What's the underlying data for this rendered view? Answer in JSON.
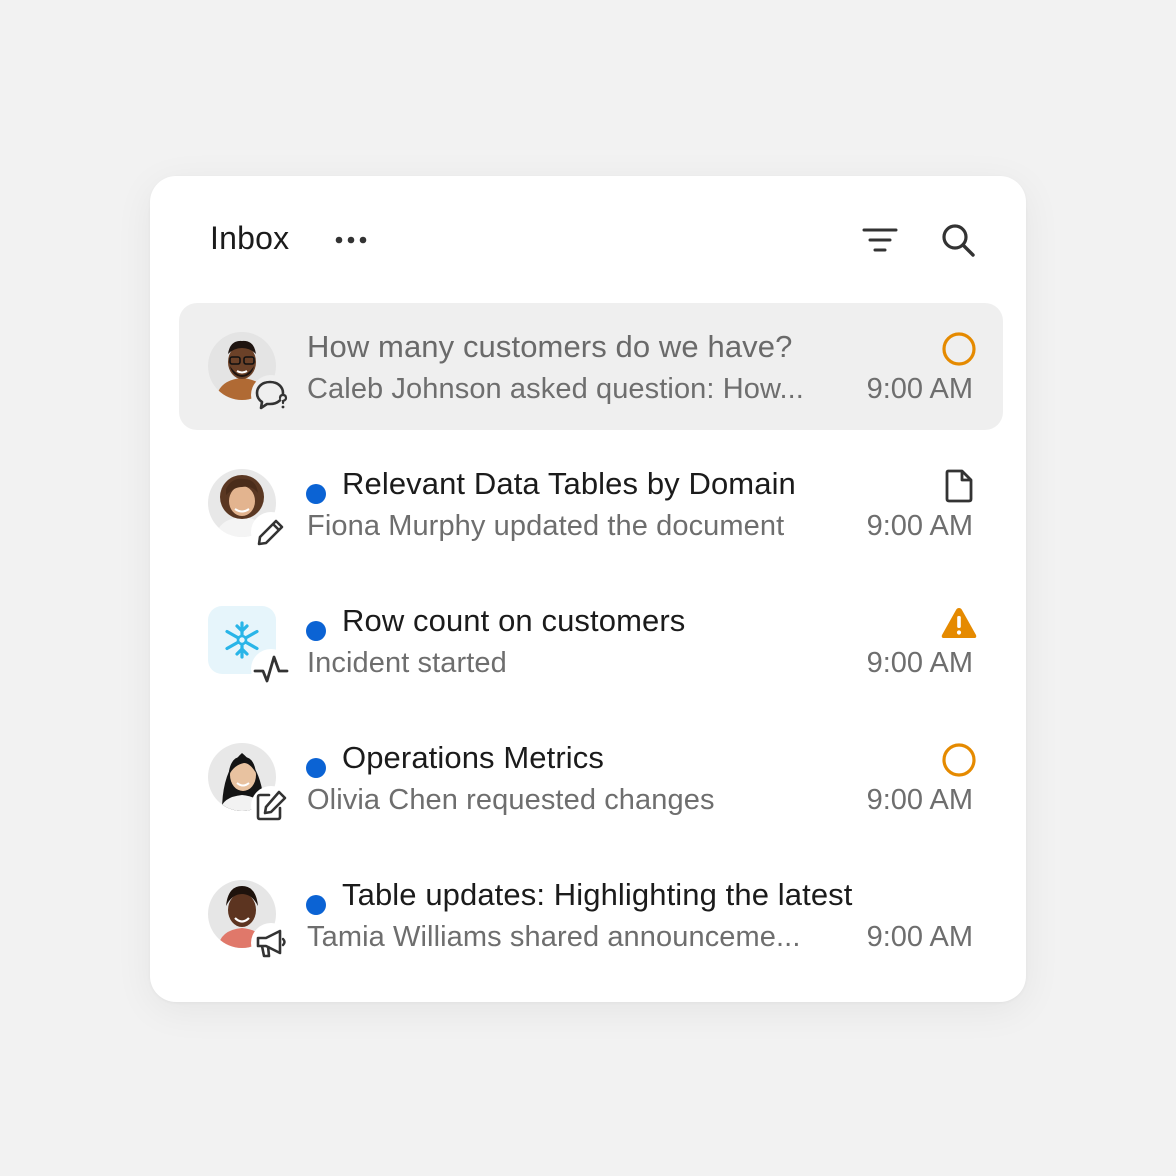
{
  "header": {
    "title": "Inbox",
    "more_icon": "more-horizontal-icon",
    "filter_icon": "filter-icon",
    "search_icon": "search-icon"
  },
  "colors": {
    "unread_dot": "#0b63d4",
    "status_orange": "#e58a00",
    "selected_row_bg": "#efefef"
  },
  "items": [
    {
      "title": "How many customers do we have?",
      "subtitle": "Caleb Johnson asked question: How...",
      "time": "9:00 AM",
      "unread": false,
      "badge_icon": "question-bubble-icon",
      "status_icon": "status-circle-icon"
    },
    {
      "title": "Relevant Data Tables by Domain",
      "subtitle": "Fiona Murphy updated the document",
      "time": "9:00 AM",
      "unread": true,
      "badge_icon": "pencil-icon",
      "status_icon": "document-icon"
    },
    {
      "title": "Row count on customers",
      "subtitle": "Incident started",
      "time": "9:00 AM",
      "unread": true,
      "badge_icon": "activity-pulse-icon",
      "status_icon": "warning-triangle-icon"
    },
    {
      "title": "Operations Metrics",
      "subtitle": "Olivia Chen requested changes",
      "time": "9:00 AM",
      "unread": true,
      "badge_icon": "edit-square-icon",
      "status_icon": "status-circle-icon"
    },
    {
      "title": "Table updates: Highlighting the latest",
      "subtitle": "Tamia Williams shared announceme...",
      "time": "9:00 AM",
      "unread": true,
      "badge_icon": "megaphone-icon",
      "status_icon": null
    }
  ]
}
